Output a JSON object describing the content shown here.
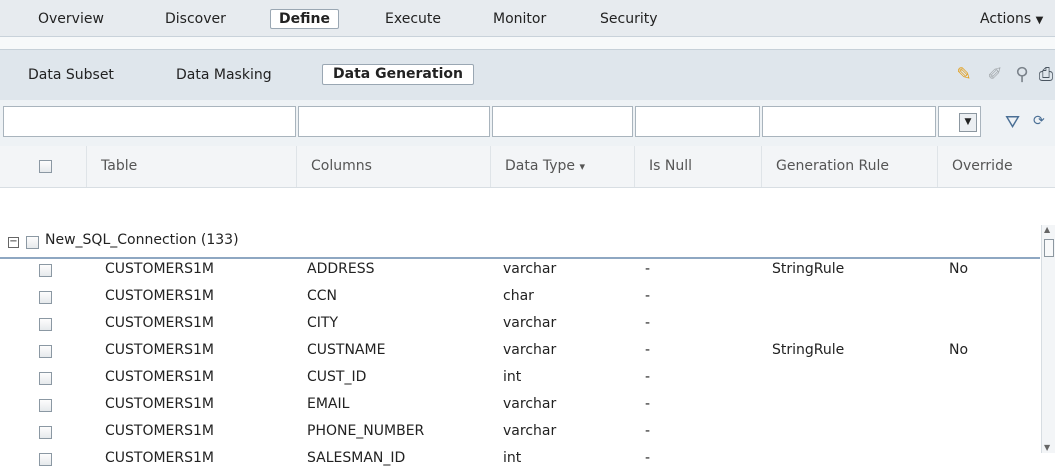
{
  "topnav": {
    "tabs": [
      {
        "label": "Overview"
      },
      {
        "label": "Discover"
      },
      {
        "label": "Define"
      },
      {
        "label": "Execute"
      },
      {
        "label": "Monitor"
      },
      {
        "label": "Security"
      }
    ],
    "active_tab": "Define",
    "actions_label": "Actions"
  },
  "subnav": {
    "tabs": [
      {
        "label": "Data Subset"
      },
      {
        "label": "Data Masking"
      },
      {
        "label": "Data Generation"
      }
    ],
    "active_tab": "Data Generation",
    "tools": [
      "pencil-icon",
      "eraser-icon",
      "link-icon",
      "print-icon"
    ]
  },
  "table": {
    "columns": [
      "Table",
      "Columns",
      "Data Type",
      "Is Null",
      "Generation Rule",
      "Override"
    ],
    "sort_indicator": "▾",
    "group": {
      "label": "New_SQL_Connection (133)"
    },
    "rows": [
      {
        "table": "CUSTOMERS1M",
        "column": "ADDRESS",
        "type": "varchar",
        "is_null": "-",
        "rule": "StringRule",
        "override": "No"
      },
      {
        "table": "CUSTOMERS1M",
        "column": "CCN",
        "type": "char",
        "is_null": "-",
        "rule": "",
        "override": ""
      },
      {
        "table": "CUSTOMERS1M",
        "column": "CITY",
        "type": "varchar",
        "is_null": "-",
        "rule": "",
        "override": ""
      },
      {
        "table": "CUSTOMERS1M",
        "column": "CUSTNAME",
        "type": "varchar",
        "is_null": "-",
        "rule": "StringRule",
        "override": "No"
      },
      {
        "table": "CUSTOMERS1M",
        "column": "CUST_ID",
        "type": "int",
        "is_null": "-",
        "rule": "",
        "override": ""
      },
      {
        "table": "CUSTOMERS1M",
        "column": "EMAIL",
        "type": "varchar",
        "is_null": "-",
        "rule": "",
        "override": ""
      },
      {
        "table": "CUSTOMERS1M",
        "column": "PHONE_NUMBER",
        "type": "varchar",
        "is_null": "-",
        "rule": "",
        "override": ""
      },
      {
        "table": "CUSTOMERS1M",
        "column": "SALESMAN_ID",
        "type": "int",
        "is_null": "-",
        "rule": "",
        "override": ""
      }
    ]
  }
}
